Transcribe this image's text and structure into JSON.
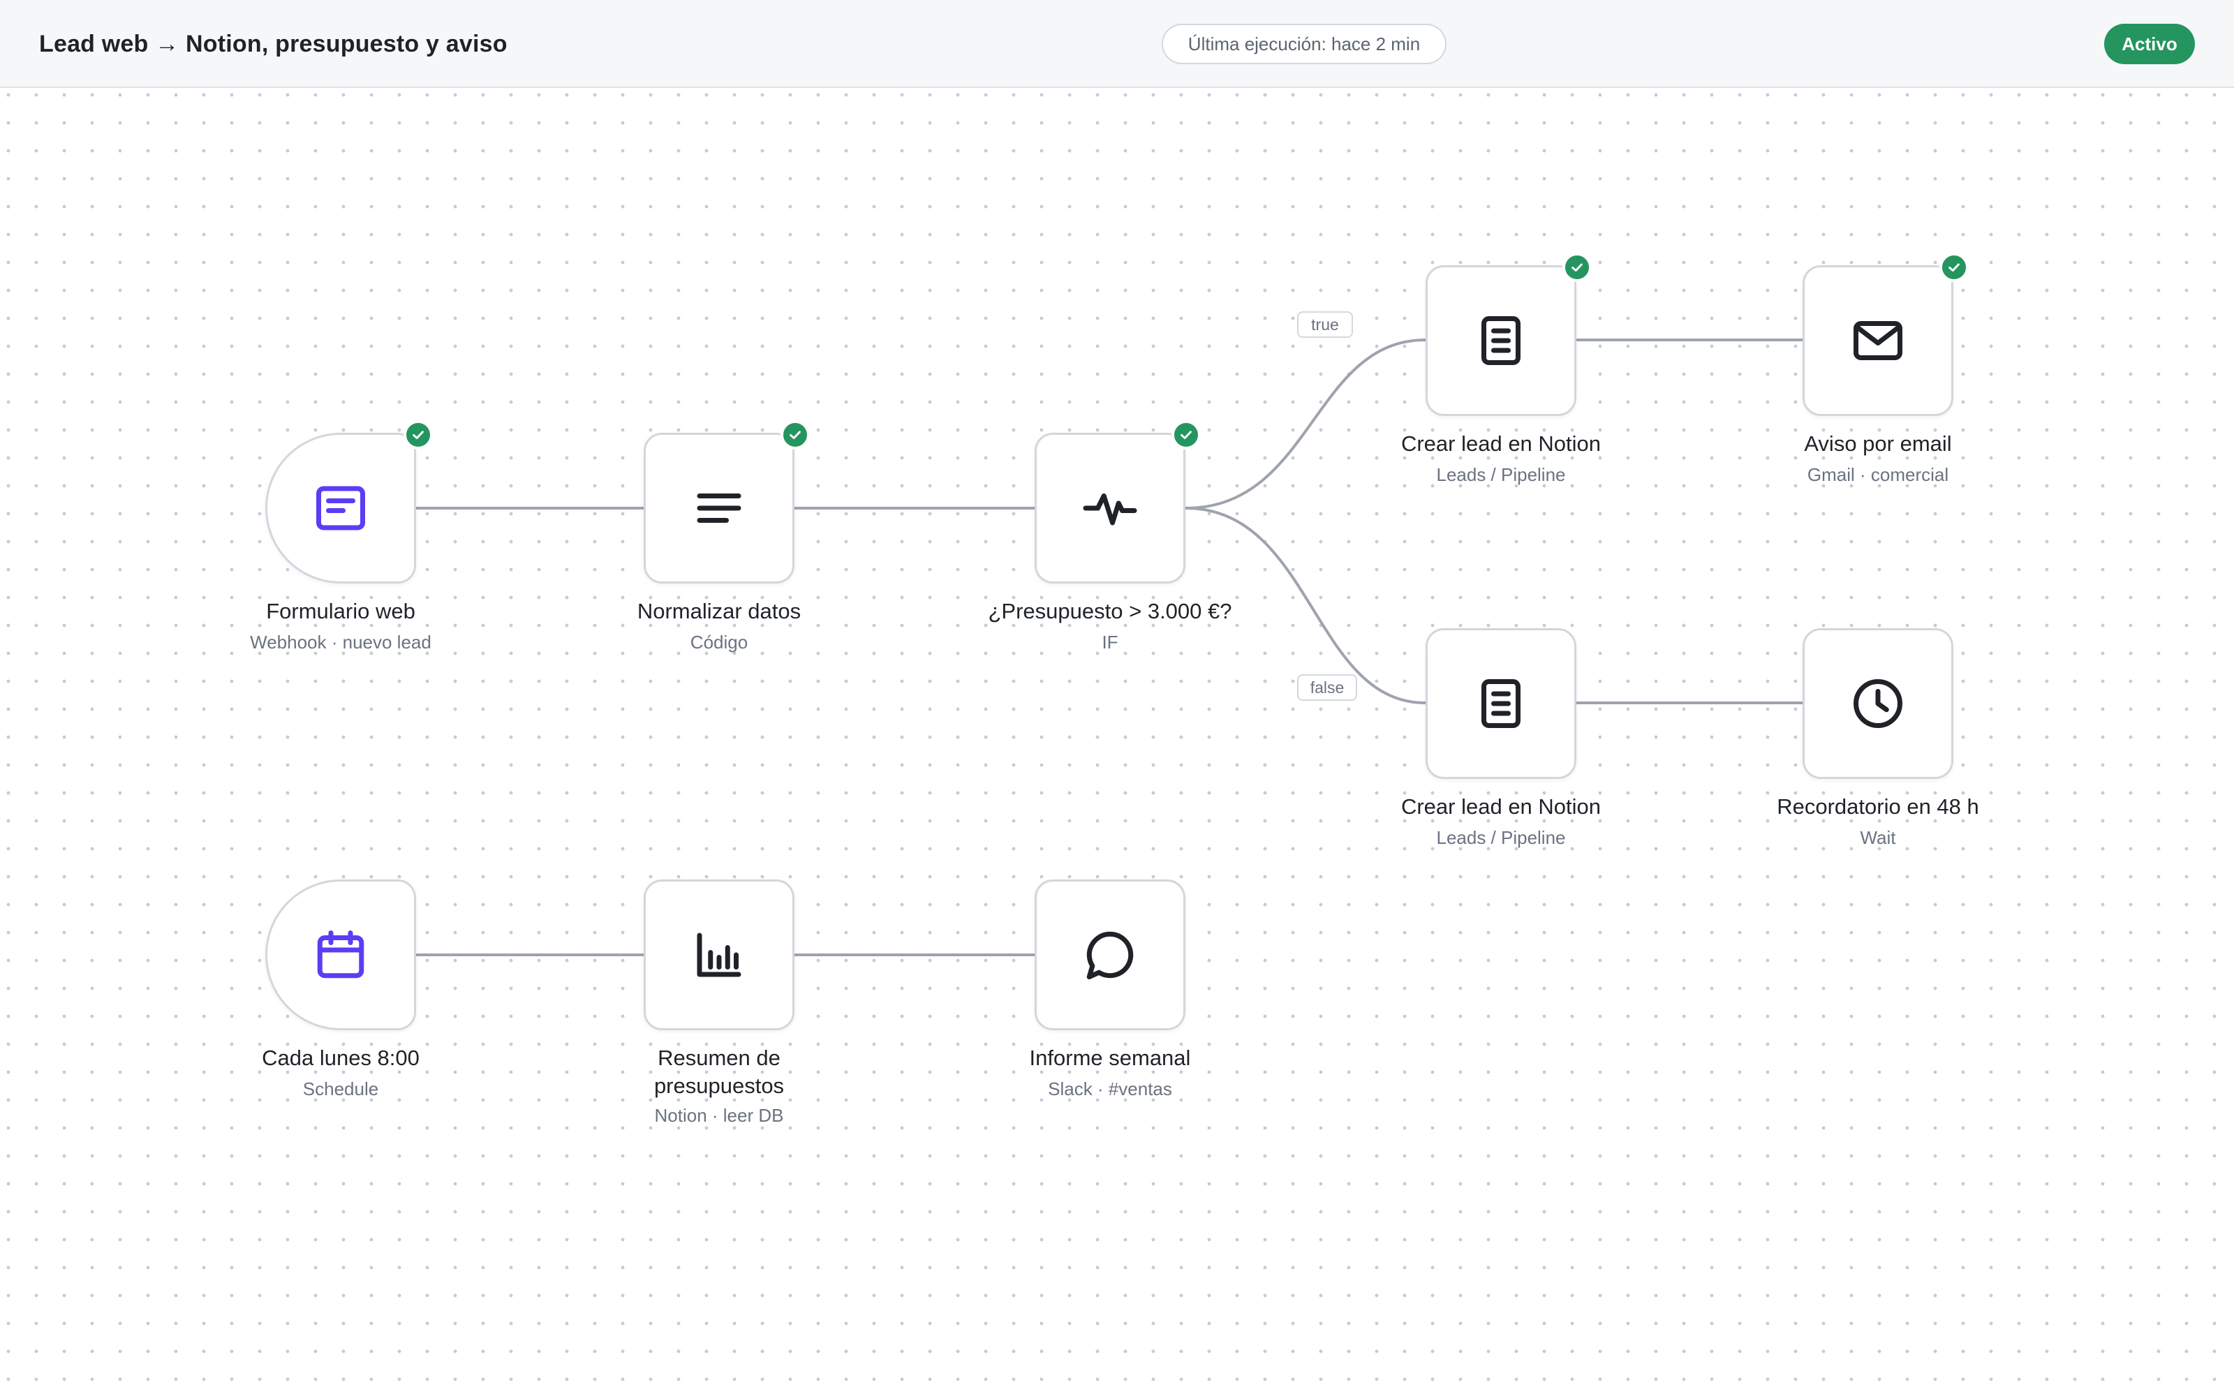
{
  "header": {
    "title": "Lead web → Notion, presupuesto y aviso",
    "last_run": "Última ejecución: hace 2 min",
    "status": "Activo"
  },
  "colors": {
    "accent": "#5b3df5",
    "success": "#25955f",
    "edge": "#9ea3ad",
    "node_border": "#d3d6dc"
  },
  "branches": {
    "true_label": "true",
    "false_label": "false"
  },
  "nodes": {
    "form": {
      "label": "Formulario web",
      "sub": "Webhook · nuevo lead",
      "icon": "form-icon",
      "completed": true
    },
    "normalize": {
      "label": "Normalizar datos",
      "sub": "Código",
      "icon": "text-lines-icon",
      "completed": true
    },
    "if": {
      "label": "¿Presupuesto > 3.000 €?",
      "sub": "IF",
      "icon": "activity-icon",
      "completed": true
    },
    "notion_true": {
      "label": "Crear lead en Notion",
      "sub": "Leads / Pipeline",
      "icon": "document-icon",
      "completed": true
    },
    "email": {
      "label": "Aviso por email",
      "sub": "Gmail · comercial",
      "icon": "mail-icon",
      "completed": true
    },
    "notion_false": {
      "label": "Crear lead en Notion",
      "sub": "Leads / Pipeline",
      "icon": "document-icon",
      "completed": false
    },
    "reminder": {
      "label": "Recordatorio en 48 h",
      "sub": "Wait",
      "icon": "clock-icon",
      "completed": false
    },
    "schedule": {
      "label": "Cada lunes 8:00",
      "sub": "Schedule",
      "icon": "calendar-icon",
      "completed": false
    },
    "summary": {
      "label_line1": "Resumen de",
      "label_line2": "presupuestos",
      "sub": "Notion · leer DB",
      "icon": "bar-chart-icon",
      "completed": false
    },
    "report": {
      "label": "Informe semanal",
      "sub": "Slack · #ventas",
      "icon": "chat-bubble-icon",
      "completed": false
    }
  }
}
